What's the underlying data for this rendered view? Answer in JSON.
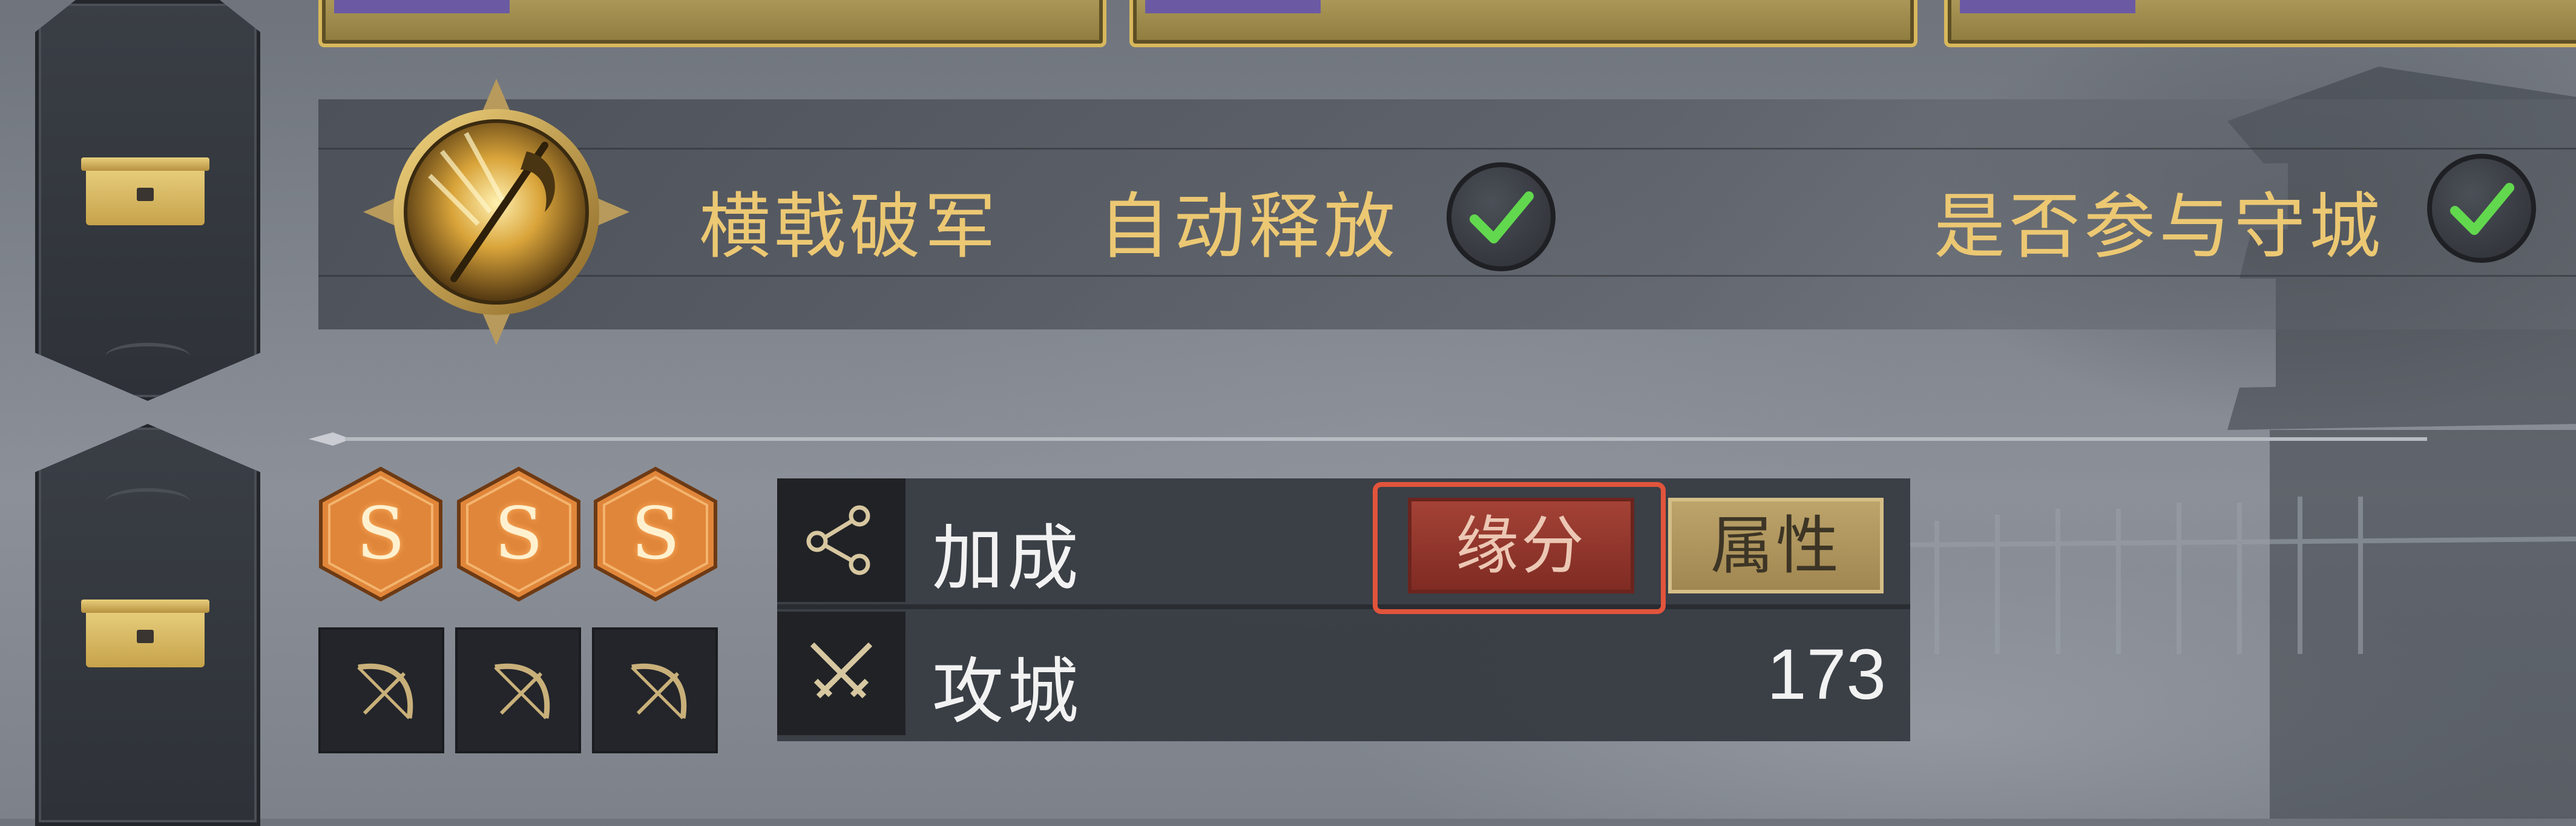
{
  "skill": {
    "name": "横戟破军",
    "auto_release_label": "自动释放",
    "auto_release_checked": true,
    "defend_city_label": "是否参与守城",
    "defend_city_checked": true
  },
  "ranks": [
    "S",
    "S",
    "S"
  ],
  "units": [
    "bow-icon",
    "bow-icon",
    "bow-icon"
  ],
  "stats": {
    "bonus_label": "加成",
    "tabs": [
      {
        "label": "缘分",
        "selected": true
      },
      {
        "label": "属性",
        "selected": false
      }
    ],
    "siege_label": "攻城",
    "siege_value": "173"
  },
  "colors": {
    "gold_text": "#ecc873",
    "check_green": "#62d84e",
    "highlight_red": "#e2543c",
    "rank_orange": "#e0863a"
  }
}
